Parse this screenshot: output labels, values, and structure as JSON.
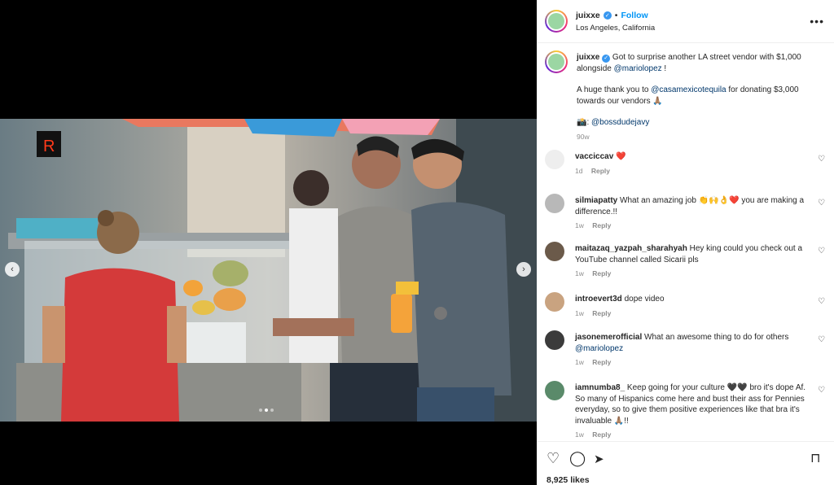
{
  "post": {
    "author": "juixxe",
    "follow_label": "Follow",
    "location": "Los Angeles, California",
    "more_icon": "more-horizontal-icon",
    "verified_mark": "✓",
    "caption_line1": "Got to surprise another LA street vendor with $1,000 alongside",
    "caption_mention1": "@mariolopez",
    "caption_line1_end": " !",
    "caption_line2_pre": "A huge thank you to ",
    "caption_mention2": "@casamexicotequila",
    "caption_line2_post": " for donating $3,000 towards our vendors 🙏🏽",
    "caption_line3_pre": "📸: ",
    "caption_mention3": "@bossdudejavy",
    "caption_time": "90w",
    "likes": "8,925 likes"
  },
  "carousel": {
    "slides": 3,
    "active": 1
  },
  "comments": [
    {
      "user": "vacciccav",
      "text": "❤️",
      "time": "1d",
      "reply": "Reply"
    },
    {
      "user": "silmiapatty",
      "text": "What an amazing job 👏🙌👌❤️ you are making a difference.!!",
      "time": "1w",
      "reply": "Reply"
    },
    {
      "user": "maitazaq_yazpah_sharahyah",
      "text": "Hey king could you check out a YouTube channel called Sicarii pls",
      "time": "1w",
      "reply": "Reply"
    },
    {
      "user": "introevert3d",
      "text": "dope video",
      "time": "1w",
      "reply": "Reply"
    },
    {
      "user": "jasonemerofficial",
      "text": "What an awesome thing to do for others",
      "mention": "@mariolopez",
      "time": "1w",
      "reply": "Reply"
    },
    {
      "user": "iamnumba8_",
      "text": "Keep going for your culture 🖤🖤 bro it's dope Af. So many of Hispanics come here and bust their ass for Pennies everyday, so to give them positive experiences like that bra it's invaluable 🙏🏽!!",
      "time": "1w",
      "reply": "Reply"
    }
  ],
  "actions": {
    "like_icon": "heart-icon",
    "comment_icon": "comment-icon",
    "share_icon": "share-icon",
    "save_icon": "bookmark-icon",
    "like_glyph": "♡",
    "comment_glyph": "◯",
    "share_glyph": "➤",
    "save_glyph": "⊓"
  },
  "photo_sign": "R",
  "colors": {
    "accent": "#0095f6",
    "verified": "#3897f0",
    "mention": "#00376b"
  }
}
